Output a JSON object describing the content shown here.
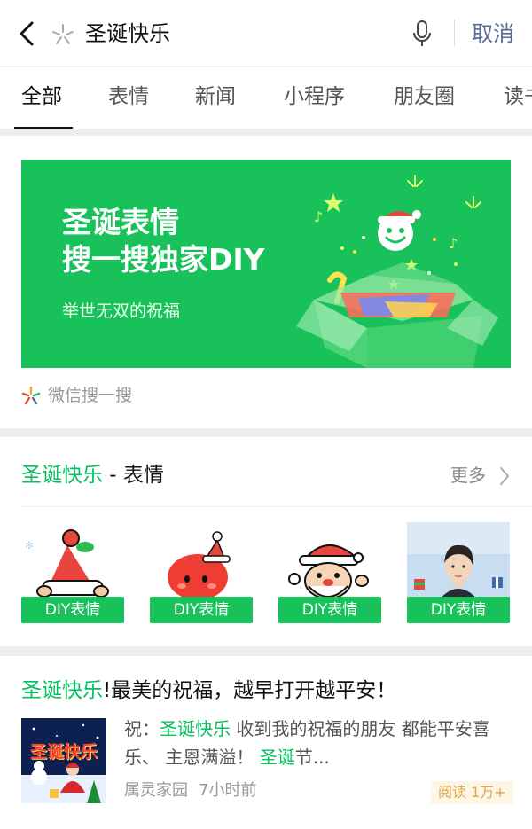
{
  "search": {
    "query": "圣诞快乐",
    "cancel_label": "取消"
  },
  "tabs": [
    {
      "label": "全部",
      "active": true
    },
    {
      "label": "表情",
      "active": false
    },
    {
      "label": "新闻",
      "active": false
    },
    {
      "label": "小程序",
      "active": false
    },
    {
      "label": "朋友圈",
      "active": false
    },
    {
      "label": "读书",
      "active": false
    }
  ],
  "banner": {
    "title_line1": "圣诞表情",
    "title_line2": "搜一搜独家DIY",
    "subtitle": "举世无双的祝福",
    "source_label": "微信搜一搜",
    "bg_color": "#19c15a"
  },
  "stickers_section": {
    "title_highlight": "圣诞快乐",
    "title_rest": " - 表情",
    "more_label": "更多",
    "items": [
      {
        "label": "DIY表情",
        "icon": "santa-hat-icon"
      },
      {
        "label": "DIY表情",
        "icon": "apple-santa-icon"
      },
      {
        "label": "DIY表情",
        "icon": "santa-character-icon"
      },
      {
        "label": "DIY表情",
        "icon": "person-photo"
      }
    ]
  },
  "article": {
    "title_highlight": "圣诞快乐",
    "title_rest": "!最美的祝福，越早打开越平安！",
    "snippet_prefix": "祝：",
    "snippet_hl1": "圣诞快乐",
    "snippet_mid": " 收到我的祝福的朋友 都能平安喜乐、 主恩满溢！ ",
    "snippet_hl2": "圣诞",
    "snippet_end": "节...",
    "source": "属灵家园",
    "time": "7小时前",
    "reads": "阅读 1万+",
    "thumbnail_text": "圣诞快乐"
  },
  "colors": {
    "accent": "#07c160",
    "link": "#576b95"
  }
}
